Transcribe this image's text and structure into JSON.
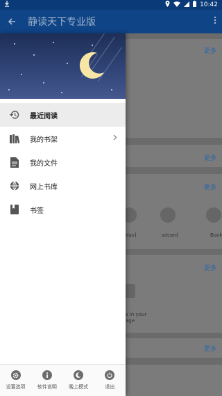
{
  "status_bar": {
    "time": "10:42"
  },
  "app_bar": {
    "title": "静读天下专业版"
  },
  "background": {
    "more_label": "更多",
    "folders": [
      "dav]",
      "sdcard",
      "Book"
    ],
    "storage_hint_line1": "s in your",
    "storage_hint_line2": "age"
  },
  "drawer": {
    "items": [
      {
        "label": "最近阅读",
        "icon": "history-icon",
        "active": true
      },
      {
        "label": "我的书架",
        "icon": "bookshelf-icon",
        "has_arrow": true
      },
      {
        "label": "我的文件",
        "icon": "file-icon"
      },
      {
        "label": "网上书库",
        "icon": "globe-icon"
      },
      {
        "label": "书签",
        "icon": "bookmark-icon"
      }
    ],
    "footer": [
      {
        "label": "设置选项",
        "icon": "gear-icon"
      },
      {
        "label": "软件说明",
        "icon": "info-icon"
      },
      {
        "label": "晚上模式",
        "icon": "moon-icon"
      },
      {
        "label": "退出",
        "icon": "power-icon"
      }
    ]
  }
}
